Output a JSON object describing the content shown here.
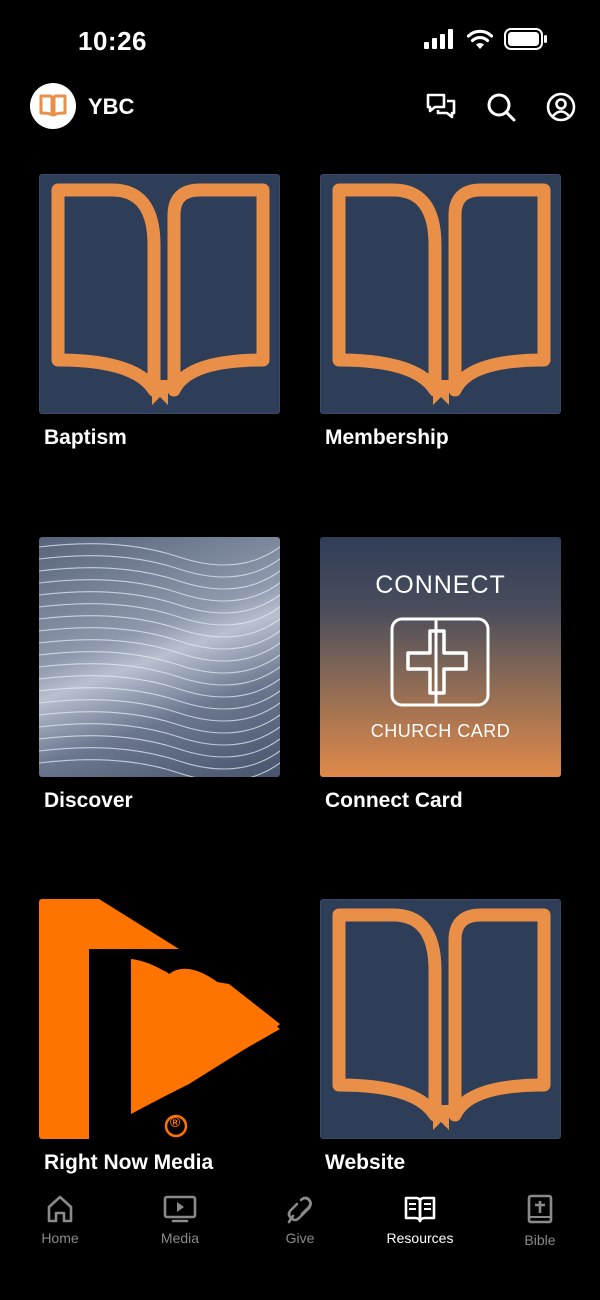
{
  "status_bar": {
    "time": "10:26"
  },
  "header": {
    "app_name": "YBC"
  },
  "tiles": [
    {
      "label": "Baptism"
    },
    {
      "label": "Membership"
    },
    {
      "label": "Discover"
    },
    {
      "label": "Connect Card",
      "thumb_title": "CONNECT",
      "thumb_subtitle": "CHURCH CARD"
    },
    {
      "label": "Right Now Media",
      "registered_mark": "®"
    },
    {
      "label": "Website"
    }
  ],
  "tabs": [
    {
      "label": "Home",
      "icon": "home-icon",
      "active": false
    },
    {
      "label": "Media",
      "icon": "media-icon",
      "active": false
    },
    {
      "label": "Give",
      "icon": "give-icon",
      "active": false
    },
    {
      "label": "Resources",
      "icon": "book-open-icon",
      "active": true
    },
    {
      "label": "Bible",
      "icon": "bible-icon",
      "active": false
    }
  ],
  "colors": {
    "accent": "#ea8f47",
    "tile_bg": "#2f3e58",
    "rnm_orange": "#ff7300",
    "inactive": "#8a8a8a"
  }
}
